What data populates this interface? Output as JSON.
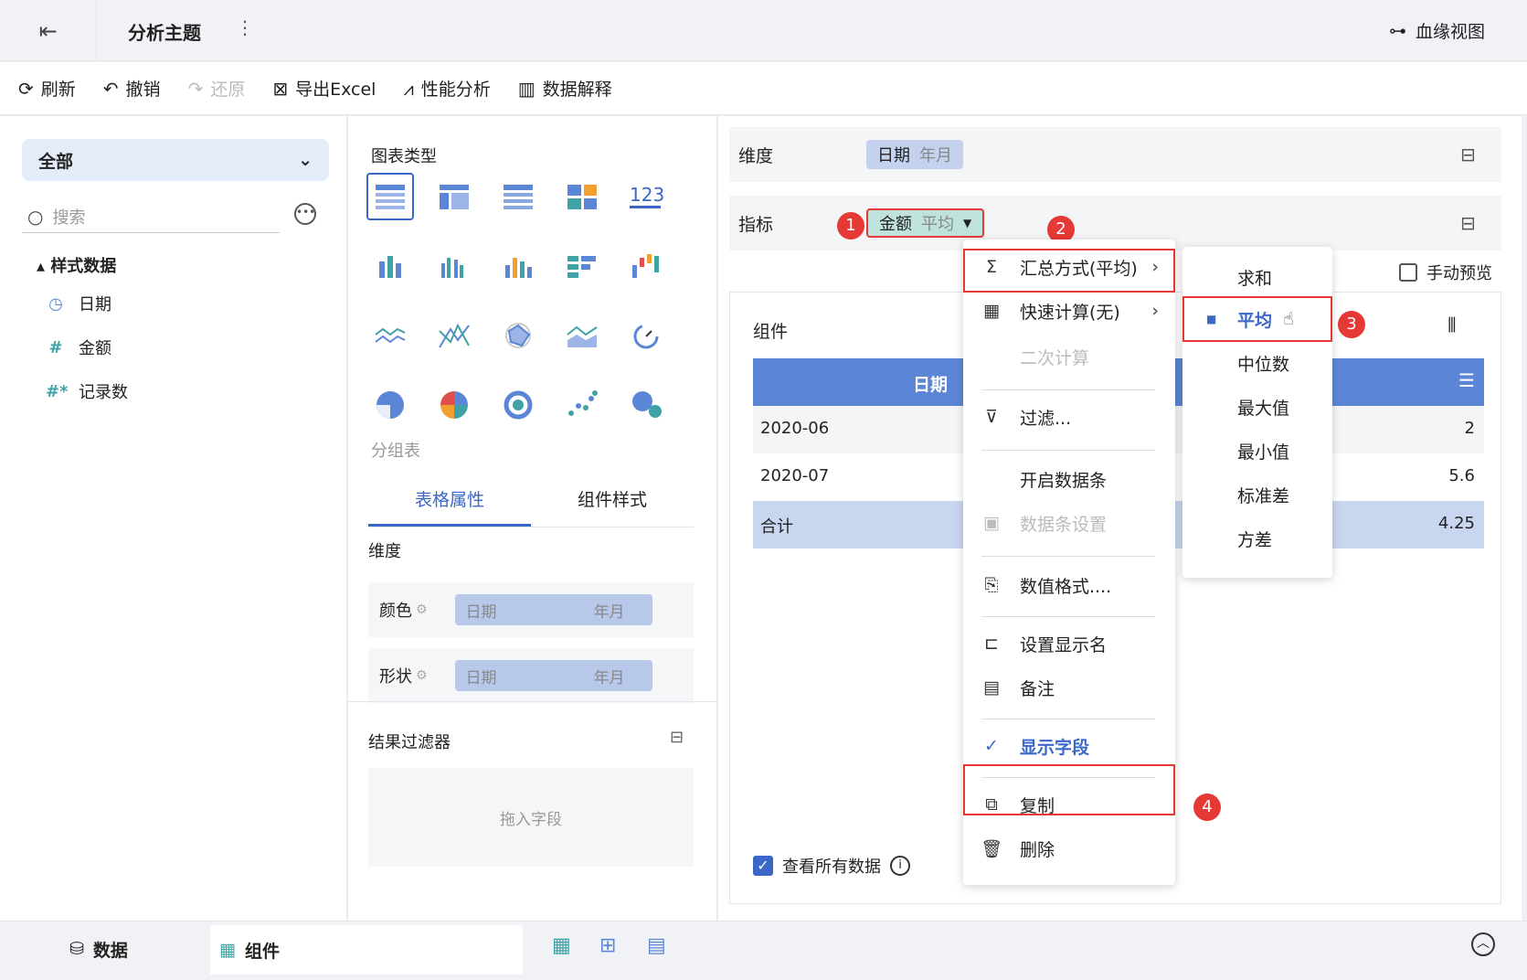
{
  "header": {
    "title": "分析主题",
    "lineage": "血缘视图"
  },
  "toolbar": {
    "refresh": "刷新",
    "undo": "撤销",
    "redo": "还原",
    "export": "导出Excel",
    "perf": "性能分析",
    "explain": "数据解释"
  },
  "sidebar": {
    "dropdown": "全部",
    "search_placeholder": "搜索",
    "group": "样式数据",
    "fields": [
      {
        "icon": "clock-icon",
        "label": "日期"
      },
      {
        "icon": "#",
        "label": "金额"
      },
      {
        "icon": "#*",
        "label": "记录数"
      }
    ]
  },
  "config": {
    "chart_type_label": "图表类型",
    "chart_sub": "分组表",
    "tabs": [
      "表格属性",
      "组件样式"
    ],
    "dim_label": "维度",
    "props": [
      {
        "label": "颜色",
        "field": "日期",
        "unit": "年月"
      },
      {
        "label": "形状",
        "field": "日期",
        "unit": "年月"
      }
    ],
    "result_filter": "结果过滤器",
    "drop_hint": "拖入字段"
  },
  "panel": {
    "dim_row": {
      "label": "维度",
      "field": "日期",
      "unit": "年月"
    },
    "metric_row": {
      "label": "指标",
      "field": "金额",
      "agg": "平均"
    },
    "manual_preview": "手动预览",
    "component": "组件",
    "table": {
      "header": "日期",
      "rows": [
        {
          "date": "2020-06",
          "value": "2"
        },
        {
          "date": "2020-07",
          "value": "5.6"
        },
        {
          "date": "合计",
          "value": "4.25"
        }
      ]
    },
    "view_all": "查看所有数据"
  },
  "menu": {
    "items": [
      "汇总方式(平均)",
      "快速计算(无)",
      "二次计算",
      "过滤...",
      "开启数据条",
      "数据条设置",
      "数值格式....",
      "设置显示名",
      "备注",
      "显示字段",
      "复制",
      "删除"
    ]
  },
  "submenu": {
    "items": [
      "求和",
      "平均",
      "中位数",
      "最大值",
      "最小值",
      "标准差",
      "方差"
    ],
    "selected": "平均"
  },
  "badges": [
    "1",
    "2",
    "3",
    "4"
  ],
  "bottom": {
    "data_tab": "数据",
    "comp_tab": "组件"
  }
}
